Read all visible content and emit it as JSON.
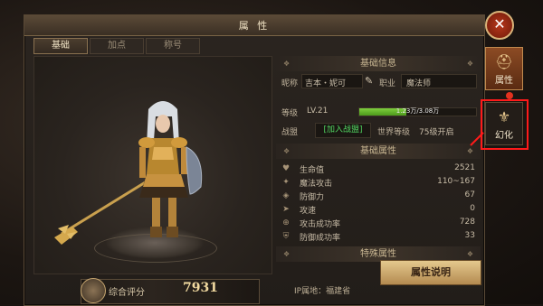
{
  "window": {
    "title": "属 性"
  },
  "tabs": [
    {
      "label": "基础",
      "active": true
    },
    {
      "label": "加点",
      "active": false
    },
    {
      "label": "称号",
      "active": false
    }
  ],
  "side_tabs": [
    {
      "label": "属性",
      "icon": "helmet-icon",
      "active": true
    },
    {
      "label": "幻化",
      "icon": "transform-icon",
      "active": false
    }
  ],
  "basic_info": {
    "header": "基础信息",
    "nickname_label": "昵称",
    "nickname": "吉本・妮可",
    "job_label": "职业",
    "job": "魔法师",
    "level_label": "等级",
    "level": "LV.21",
    "xp_text": "1.23万/3.08万",
    "xp_fraction": 0.4,
    "team_label": "战盟",
    "team_action": "[加入战盟]",
    "world_level_label": "世界等级",
    "world_level": "75级开启"
  },
  "basic_attrs": {
    "header": "基础属性",
    "items": [
      {
        "name": "生命值",
        "value": "2521",
        "icon": "heart-icon"
      },
      {
        "name": "魔法攻击",
        "value": "110~167",
        "icon": "magic-icon"
      },
      {
        "name": "防御力",
        "value": "67",
        "icon": "shield-icon"
      },
      {
        "name": "攻速",
        "value": "0",
        "icon": "speed-icon"
      },
      {
        "name": "攻击成功率",
        "value": "728",
        "icon": "target-icon"
      },
      {
        "name": "防御成功率",
        "value": "33",
        "icon": "guard-icon"
      }
    ]
  },
  "special_attrs": {
    "header": "特殊属性"
  },
  "score": {
    "label": "综合评分",
    "value": "7931"
  },
  "ip": "IP属地：福建省",
  "desc_button": "属性说明",
  "colors": {
    "accent_gold": "#e5c98e",
    "xp_green": "#7fcf3e",
    "join_green": "#51d660",
    "highlight_red": "#ff1a1a"
  }
}
